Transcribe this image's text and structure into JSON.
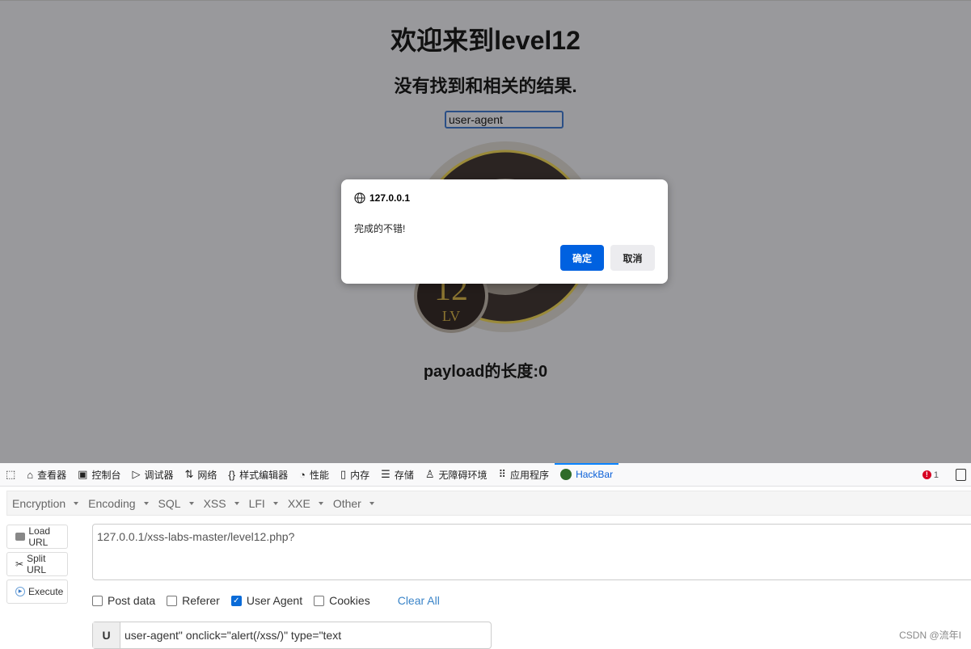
{
  "page": {
    "title": "欢迎来到level12",
    "subtitle": "没有找到和相关的结果.",
    "search_value": "user-agent",
    "payload_length": "payload的长度:0",
    "logo_text": "12 LV"
  },
  "dialog": {
    "origin": "127.0.0.1",
    "message": "完成的不错!",
    "ok": "确定",
    "cancel": "取消"
  },
  "devtools": {
    "tabs": [
      {
        "label": "查看器",
        "icon": "inspector-icon"
      },
      {
        "label": "控制台",
        "icon": "console-icon"
      },
      {
        "label": "调试器",
        "icon": "debugger-icon"
      },
      {
        "label": "网络",
        "icon": "network-icon"
      },
      {
        "label": "样式编辑器",
        "icon": "style-editor-icon"
      },
      {
        "label": "性能",
        "icon": "performance-icon"
      },
      {
        "label": "内存",
        "icon": "memory-icon"
      },
      {
        "label": "存储",
        "icon": "storage-icon"
      },
      {
        "label": "无障碍环境",
        "icon": "accessibility-icon"
      },
      {
        "label": "应用程序",
        "icon": "application-icon"
      },
      {
        "label": "HackBar",
        "icon": "hackbar-icon"
      }
    ],
    "active": "HackBar",
    "error_count": "1"
  },
  "hackbar": {
    "menu": [
      "Encryption",
      "Encoding",
      "SQL",
      "XSS",
      "LFI",
      "XXE",
      "Other"
    ],
    "load_url": "Load URL",
    "split_url": "Split URL",
    "execute": "Execute",
    "url": "127.0.0.1/xss-labs-master/level12.php?",
    "checks": [
      {
        "label": "Post data",
        "checked": false
      },
      {
        "label": "Referer",
        "checked": false
      },
      {
        "label": "User Agent",
        "checked": true
      },
      {
        "label": "Cookies",
        "checked": false
      }
    ],
    "clear_all": "Clear All",
    "ua_prefix": "U",
    "ua_value": "user-agent\" onclick=\"alert(/xss/)\" type=\"text"
  },
  "watermark": "CSDN @流年I"
}
